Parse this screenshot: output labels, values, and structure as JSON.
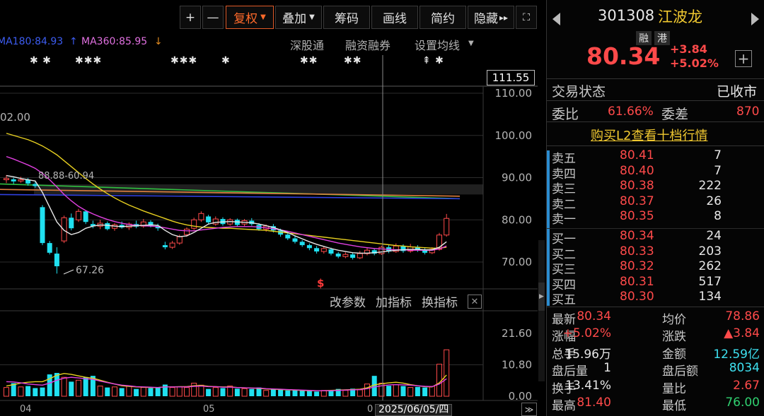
{
  "toolbar": {
    "buttons": [
      "+",
      "—",
      "复权",
      "叠加",
      "筹码",
      "画线",
      "简约",
      "隐藏"
    ],
    "hide_arrows": "▸▸"
  },
  "ma_row": {
    "ma180": "MA180:84.93",
    "ma180_arrow": "↑",
    "ma360": "MA360:85.95",
    "ma360_arrow": "↓",
    "links": [
      "深股通",
      "融资融券",
      "设置均线"
    ]
  },
  "markers": {
    "stars": [
      "✱ ✱",
      "✱✱✱",
      "✱✱✱",
      "✱",
      "✱✱",
      "✱✱",
      "⇞ ✱"
    ],
    "s_mark": "$"
  },
  "chart_data": [
    {
      "type": "candlestick",
      "title": "",
      "price_axis": [
        "111.55",
        "110.00",
        "100.00",
        "90.00",
        "80.00",
        "70.00"
      ],
      "current_price_tag": "111.55",
      "annotations": {
        "high_label": "02.00",
        "range_label": "88.88-60.94",
        "low_label": "67.26"
      },
      "candles": [
        {
          "o": 89.5,
          "c": 89.8,
          "h": 90.6,
          "l": 88.7
        },
        {
          "o": 89.6,
          "c": 89.1,
          "h": 90.0,
          "l": 88.5
        },
        {
          "o": 89.2,
          "c": 89.5,
          "h": 90.2,
          "l": 88.8
        },
        {
          "o": 89.5,
          "c": 88.6,
          "h": 89.9,
          "l": 88.1
        },
        {
          "o": 88.5,
          "c": 88.0,
          "h": 89.0,
          "l": 87.6
        },
        {
          "o": 83.0,
          "c": 74.5,
          "h": 83.5,
          "l": 74.0
        },
        {
          "o": 74.5,
          "c": 72.2,
          "h": 75.0,
          "l": 71.8
        },
        {
          "o": 72.0,
          "c": 69.0,
          "h": 73.5,
          "l": 67.26
        },
        {
          "o": 75.0,
          "c": 80.5,
          "h": 81.0,
          "l": 74.5
        },
        {
          "o": 80.5,
          "c": 78.0,
          "h": 81.5,
          "l": 77.5
        },
        {
          "o": 80.0,
          "c": 82.0,
          "h": 82.6,
          "l": 79.5
        },
        {
          "o": 82.0,
          "c": 79.5,
          "h": 82.3,
          "l": 79.0
        },
        {
          "o": 79.0,
          "c": 78.5,
          "h": 79.8,
          "l": 78.0
        },
        {
          "o": 78.5,
          "c": 79.2,
          "h": 80.0,
          "l": 77.8
        },
        {
          "o": 79.2,
          "c": 77.8,
          "h": 79.6,
          "l": 77.5
        },
        {
          "o": 78.0,
          "c": 78.8,
          "h": 79.2,
          "l": 77.4
        },
        {
          "o": 78.8,
          "c": 78.2,
          "h": 79.6,
          "l": 77.9
        },
        {
          "o": 78.2,
          "c": 79.0,
          "h": 79.4,
          "l": 77.6
        },
        {
          "o": 79.0,
          "c": 78.4,
          "h": 79.8,
          "l": 78.0
        },
        {
          "o": 78.5,
          "c": 79.5,
          "h": 80.2,
          "l": 78.1
        },
        {
          "o": 79.5,
          "c": 78.6,
          "h": 79.9,
          "l": 78.2
        },
        {
          "o": 78.6,
          "c": 78.0,
          "h": 79.1,
          "l": 77.4
        },
        {
          "o": 74.0,
          "c": 73.5,
          "h": 74.8,
          "l": 73.0
        },
        {
          "o": 73.5,
          "c": 74.5,
          "h": 75.0,
          "l": 73.1
        },
        {
          "o": 74.5,
          "c": 76.0,
          "h": 76.5,
          "l": 74.1
        },
        {
          "o": 76.5,
          "c": 77.8,
          "h": 78.2,
          "l": 76.0
        },
        {
          "o": 78.0,
          "c": 80.0,
          "h": 80.5,
          "l": 77.6
        },
        {
          "o": 80.0,
          "c": 81.5,
          "h": 82.0,
          "l": 79.5
        },
        {
          "o": 80.8,
          "c": 79.4,
          "h": 81.2,
          "l": 79.0
        },
        {
          "o": 79.0,
          "c": 80.2,
          "h": 80.8,
          "l": 78.6
        },
        {
          "o": 80.2,
          "c": 79.0,
          "h": 80.6,
          "l": 78.6
        },
        {
          "o": 79.0,
          "c": 80.0,
          "h": 80.4,
          "l": 78.6
        },
        {
          "o": 80.0,
          "c": 78.8,
          "h": 80.3,
          "l": 78.4
        },
        {
          "o": 79.0,
          "c": 79.8,
          "h": 80.2,
          "l": 78.5
        },
        {
          "o": 79.8,
          "c": 79.0,
          "h": 80.4,
          "l": 78.6
        },
        {
          "o": 78.8,
          "c": 77.8,
          "h": 79.2,
          "l": 77.4
        },
        {
          "o": 77.8,
          "c": 78.5,
          "h": 78.9,
          "l": 77.2
        },
        {
          "o": 78.5,
          "c": 77.5,
          "h": 79.0,
          "l": 77.0
        },
        {
          "o": 77.5,
          "c": 76.5,
          "h": 77.9,
          "l": 76.0
        },
        {
          "o": 76.5,
          "c": 75.6,
          "h": 77.0,
          "l": 75.2
        },
        {
          "o": 75.6,
          "c": 74.8,
          "h": 76.1,
          "l": 74.4
        },
        {
          "o": 74.8,
          "c": 74.0,
          "h": 75.2,
          "l": 73.6
        },
        {
          "o": 74.0,
          "c": 73.3,
          "h": 74.4,
          "l": 72.8
        },
        {
          "o": 73.3,
          "c": 72.5,
          "h": 73.8,
          "l": 72.0
        },
        {
          "o": 72.5,
          "c": 73.2,
          "h": 73.7,
          "l": 72.0
        },
        {
          "o": 73.0,
          "c": 72.0,
          "h": 73.4,
          "l": 71.6
        },
        {
          "o": 72.0,
          "c": 71.3,
          "h": 72.4,
          "l": 70.9
        },
        {
          "o": 71.3,
          "c": 71.8,
          "h": 72.3,
          "l": 70.9
        },
        {
          "o": 71.8,
          "c": 71.0,
          "h": 72.2,
          "l": 70.6
        },
        {
          "o": 71.0,
          "c": 72.0,
          "h": 72.6,
          "l": 70.7
        },
        {
          "o": 72.0,
          "c": 72.8,
          "h": 73.3,
          "l": 71.6
        },
        {
          "o": 72.8,
          "c": 72.0,
          "h": 73.2,
          "l": 71.6
        },
        {
          "o": 72.0,
          "c": 73.5,
          "h": 73.9,
          "l": 71.7
        },
        {
          "o": 73.5,
          "c": 72.5,
          "h": 74.0,
          "l": 72.1
        },
        {
          "o": 72.5,
          "c": 73.8,
          "h": 74.4,
          "l": 72.2
        },
        {
          "o": 73.8,
          "c": 72.6,
          "h": 74.2,
          "l": 72.2
        },
        {
          "o": 72.6,
          "c": 73.6,
          "h": 74.3,
          "l": 72.2
        },
        {
          "o": 73.6,
          "c": 72.8,
          "h": 74.0,
          "l": 72.4
        },
        {
          "o": 72.8,
          "c": 72.2,
          "h": 73.3,
          "l": 71.8
        },
        {
          "o": 72.2,
          "c": 73.0,
          "h": 73.5,
          "l": 71.9
        },
        {
          "o": 73.0,
          "c": 76.4,
          "h": 76.9,
          "l": 72.7
        },
        {
          "o": 76.4,
          "c": 80.34,
          "h": 81.4,
          "l": 76.0
        }
      ],
      "ma_short": [
        90.5,
        90.2,
        89.8,
        89.5,
        89.2,
        86.5,
        83.0,
        79.5,
        77.5,
        76.5,
        77.0,
        78.0,
        78.5,
        78.8,
        78.7,
        78.5,
        78.4,
        78.5,
        78.6,
        78.7,
        78.8,
        78.7,
        77.5,
        76.5,
        76.0,
        76.2,
        77.0,
        78.0,
        79.0,
        79.4,
        79.5,
        79.6,
        79.5,
        79.4,
        79.3,
        79.0,
        78.6,
        78.2,
        77.6,
        77.0,
        76.2,
        75.5,
        74.8,
        74.2,
        73.7,
        73.2,
        72.8,
        72.5,
        72.2,
        72.1,
        72.1,
        72.2,
        72.4,
        72.6,
        72.8,
        72.9,
        73.0,
        73.0,
        72.9,
        72.9,
        73.5,
        74.8
      ],
      "ma_mid": [
        95.0,
        94.4,
        93.7,
        93.0,
        92.2,
        91.0,
        89.5,
        87.8,
        86.0,
        84.5,
        83.2,
        82.2,
        81.4,
        80.7,
        80.1,
        79.6,
        79.2,
        78.9,
        78.7,
        78.6,
        78.5,
        78.4,
        78.1,
        77.8,
        77.5,
        77.4,
        77.4,
        77.6,
        77.8,
        78.0,
        78.2,
        78.3,
        78.4,
        78.4,
        78.4,
        78.3,
        78.1,
        77.9,
        77.6,
        77.3,
        76.9,
        76.5,
        76.1,
        75.7,
        75.3,
        74.9,
        74.5,
        74.2,
        73.9,
        73.6,
        73.4,
        73.2,
        73.1,
        73.0,
        72.9,
        72.9,
        72.8,
        72.8,
        72.8,
        72.8,
        73.1,
        73.8
      ],
      "ma_long": [
        100.5,
        100.0,
        99.5,
        99.0,
        98.3,
        97.5,
        96.5,
        95.4,
        94.0,
        92.6,
        91.2,
        89.8,
        88.5,
        87.3,
        86.2,
        85.2,
        84.3,
        83.5,
        82.8,
        82.1,
        81.5,
        80.9,
        80.3,
        79.7,
        79.2,
        78.8,
        78.5,
        78.3,
        78.2,
        78.1,
        78.0,
        78.0,
        77.9,
        77.8,
        77.7,
        77.6,
        77.5,
        77.3,
        77.1,
        76.9,
        76.7,
        76.5,
        76.3,
        76.1,
        75.9,
        75.7,
        75.5,
        75.3,
        75.1,
        74.9,
        74.7,
        74.5,
        74.3,
        74.1,
        73.9,
        73.8,
        73.6,
        73.5,
        73.4,
        73.3,
        73.3,
        73.5
      ],
      "ma_green": [
        88.5,
        85.0
      ],
      "ma_orange": [
        87.2,
        85.6
      ],
      "ma_blue": [
        86.0,
        85.0
      ]
    },
    {
      "type": "bar",
      "title": "",
      "axis": [
        "21.60",
        "10.80",
        "0.00"
      ],
      "ylim": [
        0,
        21.6
      ],
      "volumes": [
        3.0,
        4.5,
        3.2,
        3.5,
        2.8,
        3.0,
        7.5,
        8.0,
        6.5,
        5.0,
        5.5,
        6.5,
        7.0,
        3.5,
        3.0,
        3.2,
        2.8,
        3.5,
        2.5,
        3.0,
        2.8,
        3.0,
        4.0,
        3.0,
        3.2,
        3.0,
        4.5,
        3.8,
        2.5,
        3.0,
        2.8,
        3.5,
        2.6,
        2.6,
        2.5,
        3.0,
        2.0,
        2.5,
        2.2,
        2.0,
        2.3,
        2.0,
        1.8,
        1.6,
        2.0,
        1.8,
        2.5,
        2.0,
        2.6,
        2.2,
        4.2,
        7.0,
        4.5,
        3.6,
        4.0,
        3.5,
        3.0,
        3.2,
        3.0,
        3.4,
        11.0,
        15.96
      ],
      "ma_a": [
        5.0,
        4.9,
        4.6,
        4.2,
        4.0,
        3.8,
        4.5,
        5.5,
        6.2,
        6.5,
        6.3,
        6.0,
        5.8,
        5.2,
        4.7,
        4.2,
        3.8,
        3.6,
        3.3,
        3.2,
        3.1,
        3.0,
        3.2,
        3.2,
        3.2,
        3.2,
        3.4,
        3.5,
        3.3,
        3.3,
        3.1,
        3.1,
        3.0,
        2.9,
        2.8,
        2.8,
        2.6,
        2.5,
        2.4,
        2.3,
        2.2,
        2.1,
        2.0,
        1.9,
        1.9,
        1.9,
        2.0,
        2.1,
        2.2,
        2.3,
        2.6,
        3.2,
        3.6,
        3.9,
        4.0,
        3.9,
        3.8,
        3.6,
        3.4,
        3.3,
        4.2,
        6.0
      ],
      "ma_b": [
        3.5,
        4.0,
        4.5,
        4.8,
        5.0,
        5.0,
        6.0,
        7.2,
        7.8,
        7.5,
        7.0,
        6.5,
        6.2,
        5.5,
        4.8,
        4.2,
        3.6,
        3.4,
        3.2,
        3.1,
        3.0,
        3.0,
        3.2,
        3.2,
        3.3,
        3.3,
        3.6,
        3.7,
        3.4,
        3.3,
        3.2,
        3.2,
        3.0,
        2.9,
        2.8,
        2.7,
        2.5,
        2.4,
        2.3,
        2.2,
        2.1,
        2.0,
        1.9,
        1.9,
        1.9,
        2.0,
        2.1,
        2.2,
        2.3,
        2.4,
        2.9,
        3.9,
        4.3,
        4.6,
        4.8,
        4.5,
        4.0,
        3.6,
        3.3,
        3.2,
        4.6,
        7.3
      ]
    }
  ],
  "indicator_bar": {
    "labels": [
      "改参数",
      "加指标",
      "换指标"
    ],
    "close": "✕"
  },
  "x_axis": {
    "month_04": "04",
    "month_05": "05",
    "month_c": "0",
    "cursor_date": "2025/06/05/四",
    "expand": "≫"
  },
  "panel": {
    "code": "301308",
    "name": "江波龙",
    "badges": [
      "融",
      "港"
    ],
    "last": "80.34",
    "change": "+3.84",
    "change_pct": "+5.02%",
    "add": "+",
    "trade_status_label": "交易状态",
    "trade_status": "已收市",
    "weibi_label": "委比",
    "weibi": "61.66%",
    "weicha_label": "委差",
    "weicha": "870",
    "l2_link": "购买L2查看十档行情",
    "asks": [
      {
        "label": "卖五",
        "price": "80.41",
        "vol": "7"
      },
      {
        "label": "卖四",
        "price": "80.40",
        "vol": "7"
      },
      {
        "label": "卖三",
        "price": "80.38",
        "vol": "222"
      },
      {
        "label": "卖二",
        "price": "80.37",
        "vol": "26"
      },
      {
        "label": "卖一",
        "price": "80.35",
        "vol": "8"
      }
    ],
    "bids": [
      {
        "label": "买一",
        "price": "80.34",
        "vol": "24"
      },
      {
        "label": "买二",
        "price": "80.33",
        "vol": "203"
      },
      {
        "label": "买三",
        "price": "80.32",
        "vol": "262"
      },
      {
        "label": "买四",
        "price": "80.31",
        "vol": "517"
      },
      {
        "label": "买五",
        "price": "80.30",
        "vol": "134"
      }
    ],
    "stats": [
      {
        "l1": "最新",
        "v1": "80.34",
        "c1": "red",
        "l2": "均价",
        "v2": "78.86",
        "c2": "red"
      },
      {
        "l1": "涨幅",
        "v1": "+5.02%",
        "c1": "red",
        "l2": "涨跌",
        "v2": "▲3.84",
        "c2": "red"
      },
      {
        "l1": "总手",
        "v1": "15.96万",
        "c1": "white",
        "l2": "金额",
        "v2": "12.59亿",
        "c2": "cyan"
      },
      {
        "l1": "盘后量",
        "v1": "1",
        "c1": "white",
        "l2": "盘后额",
        "v2": "8034",
        "c2": "cyan"
      },
      {
        "l1": "换手",
        "v1": "13.41%",
        "c1": "white",
        "l2": "量比",
        "v2": "2.67",
        "c2": "red"
      },
      {
        "l1": "最高",
        "v1": "81.40",
        "c1": "red",
        "l2": "最低",
        "v2": "76.00",
        "c2": "green"
      }
    ]
  },
  "colors": {
    "up": "#ff4a4a",
    "down": "#20e0f0",
    "ma_short": "#e8e8e8",
    "ma_mid": "#e040e0",
    "ma_long": "#e8d020",
    "ma_green": "#30c040",
    "ma_orange": "#e08040",
    "ma_blue": "#3040e0",
    "vol_ma_a": "#e040e0",
    "vol_ma_b": "#e8d020"
  }
}
